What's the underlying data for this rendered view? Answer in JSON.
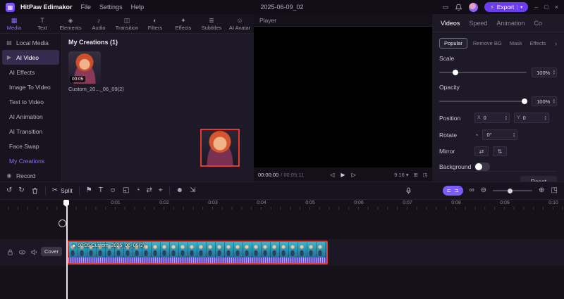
{
  "titlebar": {
    "app_name": "HitPaw Edimakor",
    "menus": [
      "File",
      "Settings",
      "Help"
    ],
    "document_title": "2025-06-09_02",
    "export_label": "Export"
  },
  "ribbon": {
    "tabs": [
      {
        "label": "Media"
      },
      {
        "label": "Text"
      },
      {
        "label": "Elements"
      },
      {
        "label": "Audio"
      },
      {
        "label": "Transition"
      },
      {
        "label": "Filters"
      },
      {
        "label": "Effects"
      },
      {
        "label": "Subtitles"
      },
      {
        "label": "AI Avatar"
      }
    ],
    "active_tab": "Media"
  },
  "sidebar": {
    "items": [
      {
        "label": "Local Media"
      },
      {
        "label": "AI Video"
      },
      {
        "label": "AI Effects"
      },
      {
        "label": "Image To Video"
      },
      {
        "label": "Text to Video"
      },
      {
        "label": "AI Animation"
      },
      {
        "label": "AI Transition"
      },
      {
        "label": "Face Swap"
      },
      {
        "label": "My Creations"
      },
      {
        "label": "Record"
      }
    ],
    "active_item": "AI Video",
    "highlighted_item": "My Creations"
  },
  "media_panel": {
    "section_title": "My Creations (1)",
    "item": {
      "duration": "00:05",
      "name": "Custom_20..._06_09(2)"
    }
  },
  "player": {
    "title": "Player",
    "current_time": "00:00:00",
    "total_time": "/ 00:05:11",
    "ratio": "9:16"
  },
  "properties": {
    "tabs": [
      "Videos",
      "Speed",
      "Animation",
      "Co"
    ],
    "active_tab": "Videos",
    "chips": [
      "Popular",
      "Remove BG",
      "Mask",
      "Effects"
    ],
    "active_chip": "Popular",
    "scale_label": "Scale",
    "scale_value": "100%",
    "opacity_label": "Opacity",
    "opacity_value": "100%",
    "position_label": "Position",
    "position_x_label": "X",
    "position_x_value": "0",
    "position_y_label": "Y",
    "position_y_value": "0",
    "rotate_label": "Rotate",
    "rotate_value": "0°",
    "mirror_label": "Mirror",
    "background_label": "Background",
    "reset_label": "Reset"
  },
  "timeline": {
    "split_label": "Split",
    "ruler_labels": [
      "0:01",
      "0:02",
      "0:03",
      "0:04",
      "0:05",
      "0:06",
      "0:07",
      "0:08",
      "0:09",
      "0:10"
    ],
    "cover_label": "Cover",
    "clip_label": "00:05 Custom_2025_06_09(2)"
  },
  "colors": {
    "accent_purple": "#7c5cfa",
    "selection_red": "#e8372c"
  },
  "icons": {
    "logo": "▦",
    "display": "▭",
    "minimize": "–",
    "maximize": "□",
    "close": "×",
    "bolt": "⚡",
    "chevron_down": "▾",
    "chevron_right": "›",
    "tab_media": "▦",
    "tab_text": "T",
    "tab_elements": "◈",
    "tab_audio": "♪",
    "tab_transition": "◫",
    "tab_filters": "◐",
    "tab_effects": "✦",
    "tab_subtitles": "≣",
    "tab_ai_avatar": "☺",
    "folder": "▤",
    "ai_video": "▶",
    "record": "◉",
    "prev_frame": "◁",
    "play": "▶",
    "next_frame": "▷",
    "grid": "⊞",
    "fullscreen": "◳",
    "undo": "↺",
    "redo": "↻",
    "scissors": "✂",
    "marker_flag": "⚑",
    "text_tool": "T",
    "sticker": "☺",
    "crop": "◱",
    "speed_gauge": "◔",
    "flip": "⇄",
    "transform_target": "⌖",
    "face_swap": "☻",
    "export_frame": "⇲",
    "snap_left": "⊏",
    "snap_right": "⊐",
    "link": "∞",
    "zoom_out": "⊖",
    "zoom_in": "⊕",
    "fit": "◳",
    "rotate_dial": "◔",
    "mirror_h": "⇄",
    "mirror_v": "⇅",
    "spin_up": "▴",
    "spin_down": "▾",
    "clip_dot": "◉"
  }
}
